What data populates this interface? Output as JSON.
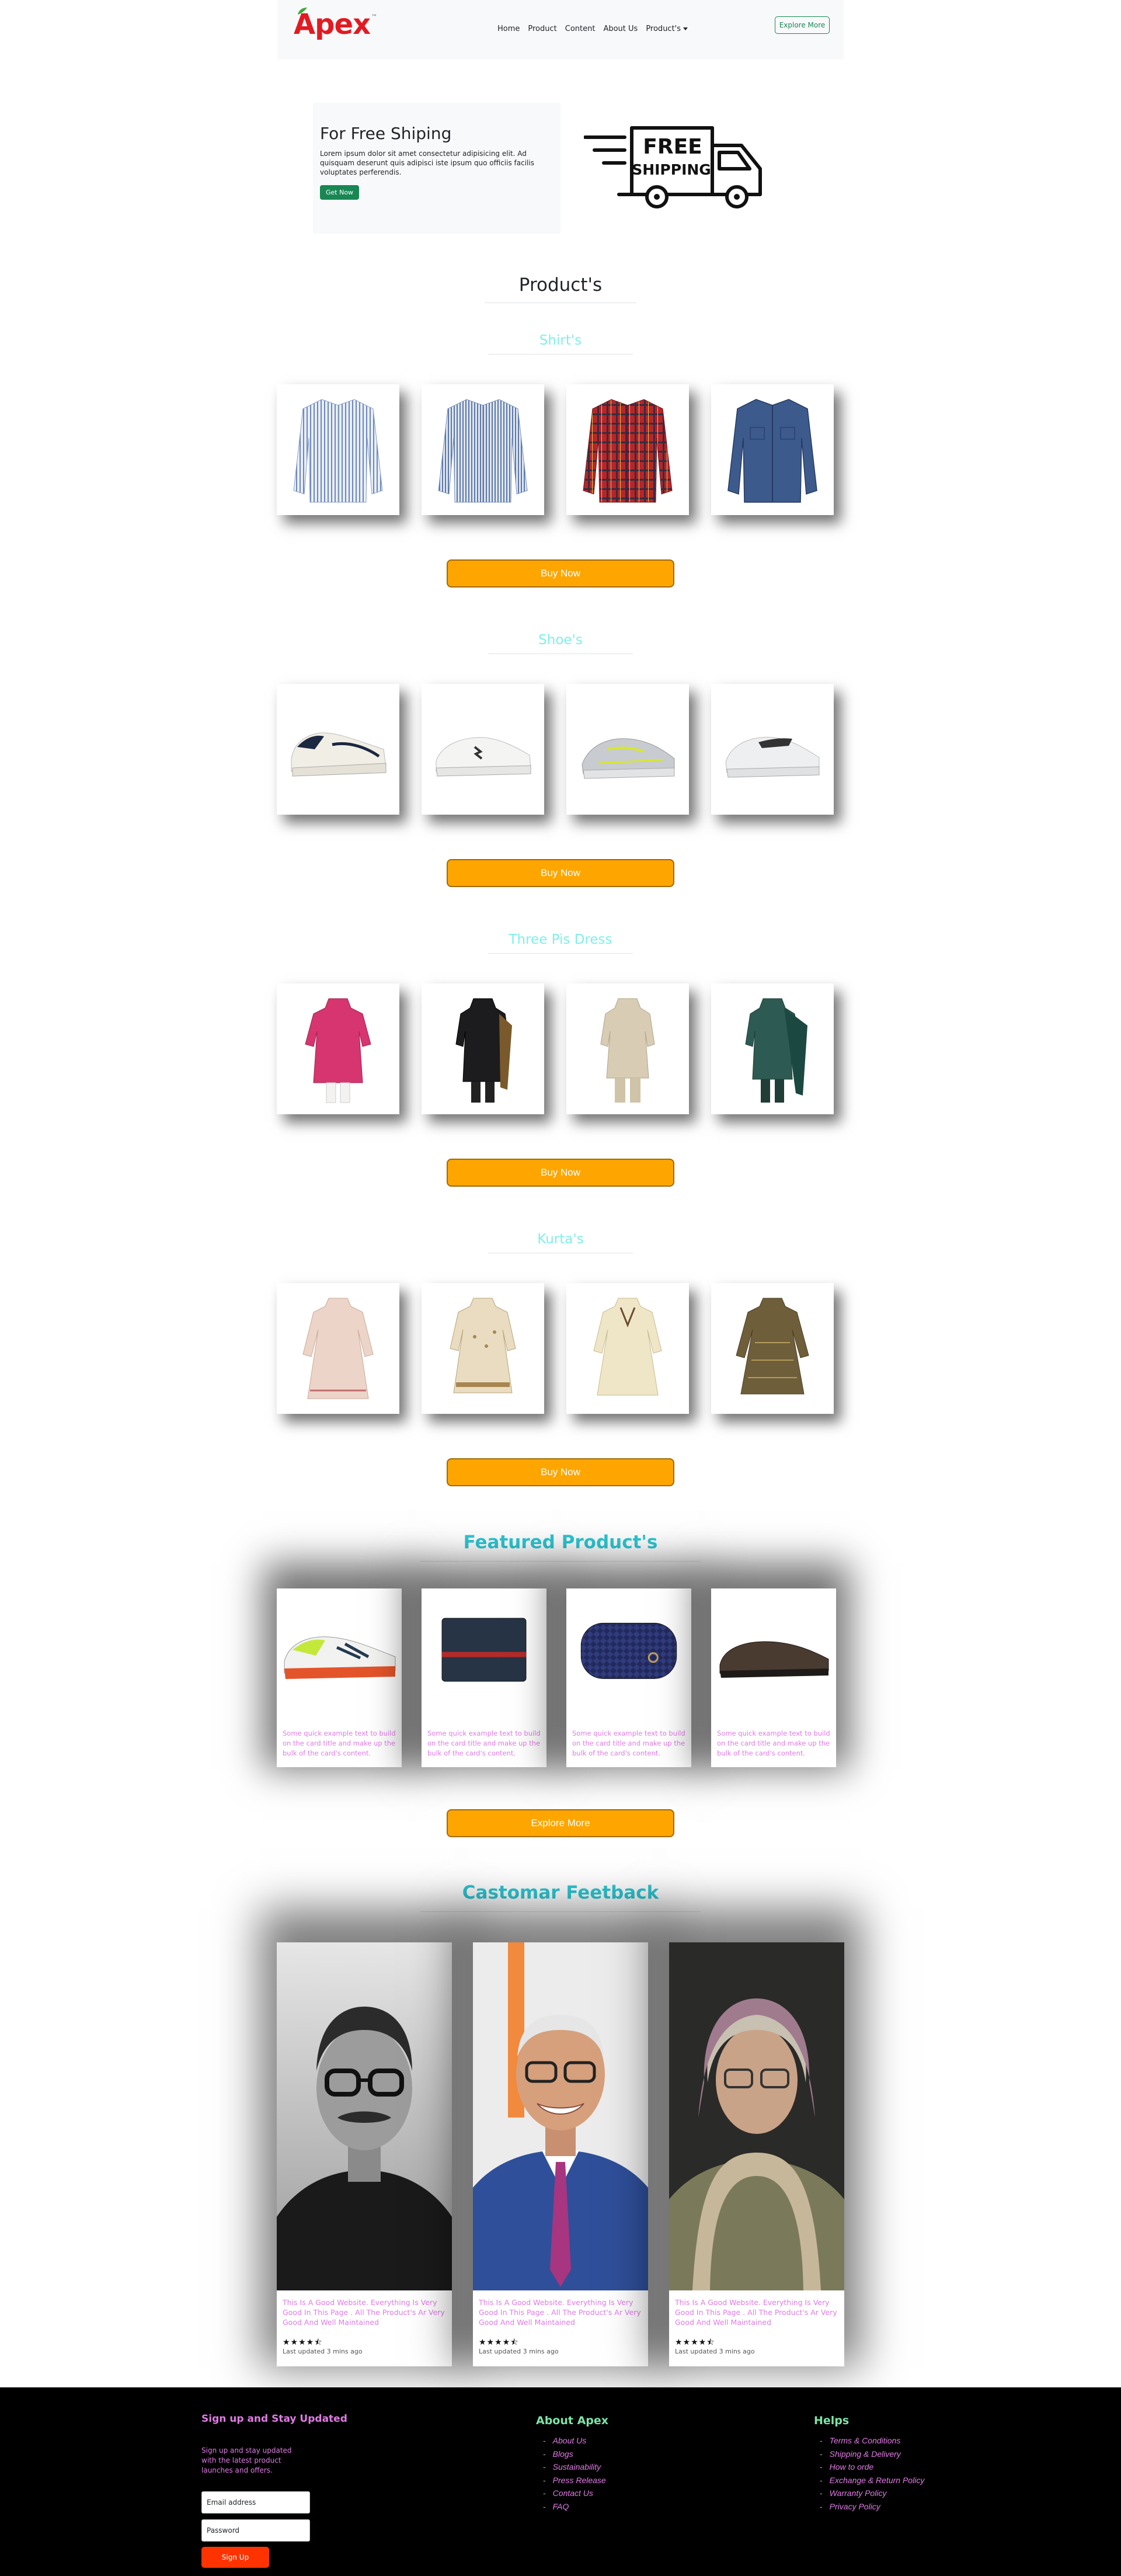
{
  "nav": {
    "brand": "Apex",
    "tm": "™",
    "links": [
      "Home",
      "Product",
      "Content",
      "About Us",
      "Product's"
    ],
    "explore": "Explore More"
  },
  "hero": {
    "title": "For Free Shiping",
    "text": "Lorem ipsum dolor sit amet consectetur adipisicing elit. Ad quisquam deserunt quis adipisci iste ipsum quo officiis facilis voluptates perferendis.",
    "button": "Get Now",
    "truck_line1": "FREE",
    "truck_line2": "SHIPPING"
  },
  "products": {
    "heading": "Product's",
    "categories": [
      {
        "name": "Shirt's",
        "button": "Buy Now"
      },
      {
        "name": "Shoe's",
        "button": "Buy Now"
      },
      {
        "name": "Three Pis Dress",
        "button": "Buy Now"
      },
      {
        "name": "Kurta's",
        "button": "Buy Now"
      }
    ]
  },
  "featured": {
    "heading": "Featured Product's",
    "card_text": "Some quick example text to build on the card title and make up the bulk of the card's content.",
    "button": "Explore More"
  },
  "feedback": {
    "heading": "Castomar Feetback",
    "text": "This Is A Good Website. Everything Is Very Good In This Page . All The Product's Ar Very Good And Well Maintained",
    "stars": "★★★★⯪",
    "updated": "Last updated 3 mins ago"
  },
  "footer": {
    "signup_title": "Sign up and Stay Updated",
    "signup_text": "Sign up and stay updated with the latest product launches and offers.",
    "email_placeholder": "Email address",
    "password_placeholder": "Password",
    "signup_button": "Sign Up",
    "about_title": "About Apex",
    "about_links": [
      "About Us",
      "Blogs",
      "Sustainability",
      "Press Release",
      "Contact Us",
      "FAQ"
    ],
    "help_title": "Helps",
    "help_links": [
      "Terms & Conditions",
      "Shipping & Delivery",
      "How to orde",
      "Exchange & Return Policy",
      "Warranty Policy",
      "Privacy Policy"
    ]
  },
  "colors": {
    "brand": "#e21b22",
    "accent_orange": "#ffa500",
    "cyan_heading": "#2ec8d4",
    "light_cyan": "#7ef0e8",
    "pink_text": "#e17ae6",
    "green": "#198754",
    "footer_bg": "#000000",
    "footer_heading_green": "#7be5a8",
    "signup_button": "#ff3300"
  }
}
